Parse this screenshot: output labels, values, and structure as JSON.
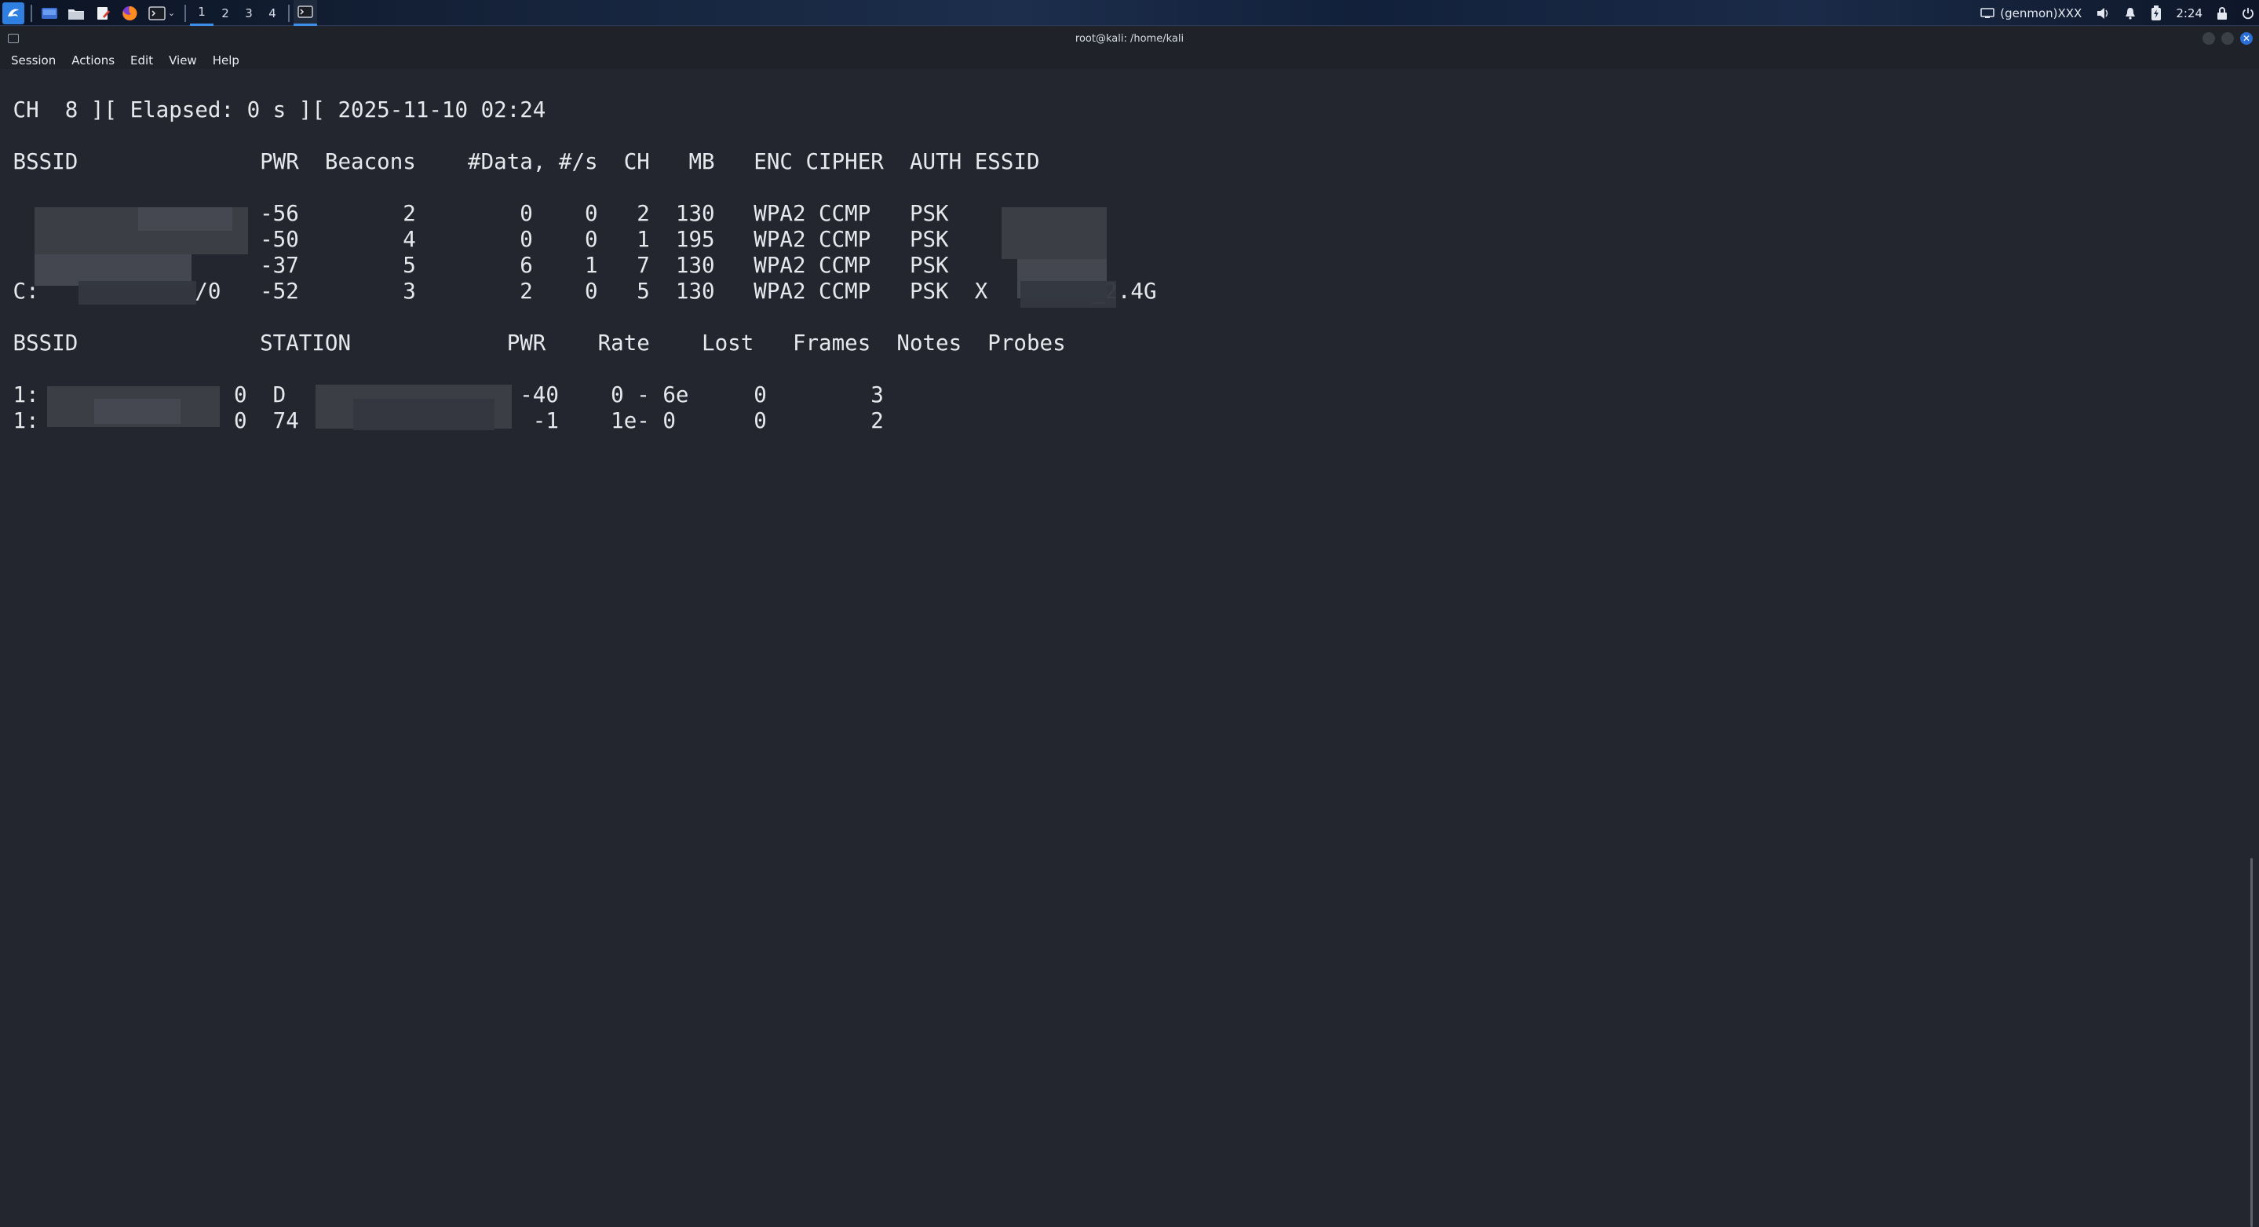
{
  "panel": {
    "workspaces": [
      "1",
      "2",
      "3",
      "4"
    ],
    "active_workspace": "1",
    "tray": {
      "monitor_label": "(genmon)XXX",
      "clock": "2:24"
    }
  },
  "window": {
    "title": "root@kali: /home/kali",
    "menu": [
      "Session",
      "Actions",
      "Edit",
      "View",
      "Help"
    ]
  },
  "terminal": {
    "status_line": " CH  8 ][ Elapsed: 0 s ][ 2025-11-10 02:24",
    "ap_header": " BSSID              PWR  Beacons    #Data, #/s  CH   MB   ENC CIPHER  AUTH ESSID",
    "ap_rows": [
      "                    -56        2        0    0   2  130   WPA2 CCMP   PSK",
      "                    -50        4        0    0   1  195   WPA2 CCMP   PSK",
      "                    -37        5        6    1   7  130   WPA2 CCMP   PSK",
      " C:            /0   -52        3        2    0   5  130   WPA2 CCMP   PSK  X        _2.4G"
    ],
    "station_header": " BSSID              STATION            PWR    Rate    Lost   Frames  Notes  Probes",
    "station_rows": [
      " 1:               0  D                  -40    0 - 6e     0        3",
      " 1:               0  74                  -1    1e- 0      0        2"
    ]
  },
  "colors": {
    "terminal_bg": "#23262e",
    "terminal_fg": "#e6e8ec",
    "accent": "#3d8ee8",
    "titlebar_bg": "#1f2229"
  }
}
